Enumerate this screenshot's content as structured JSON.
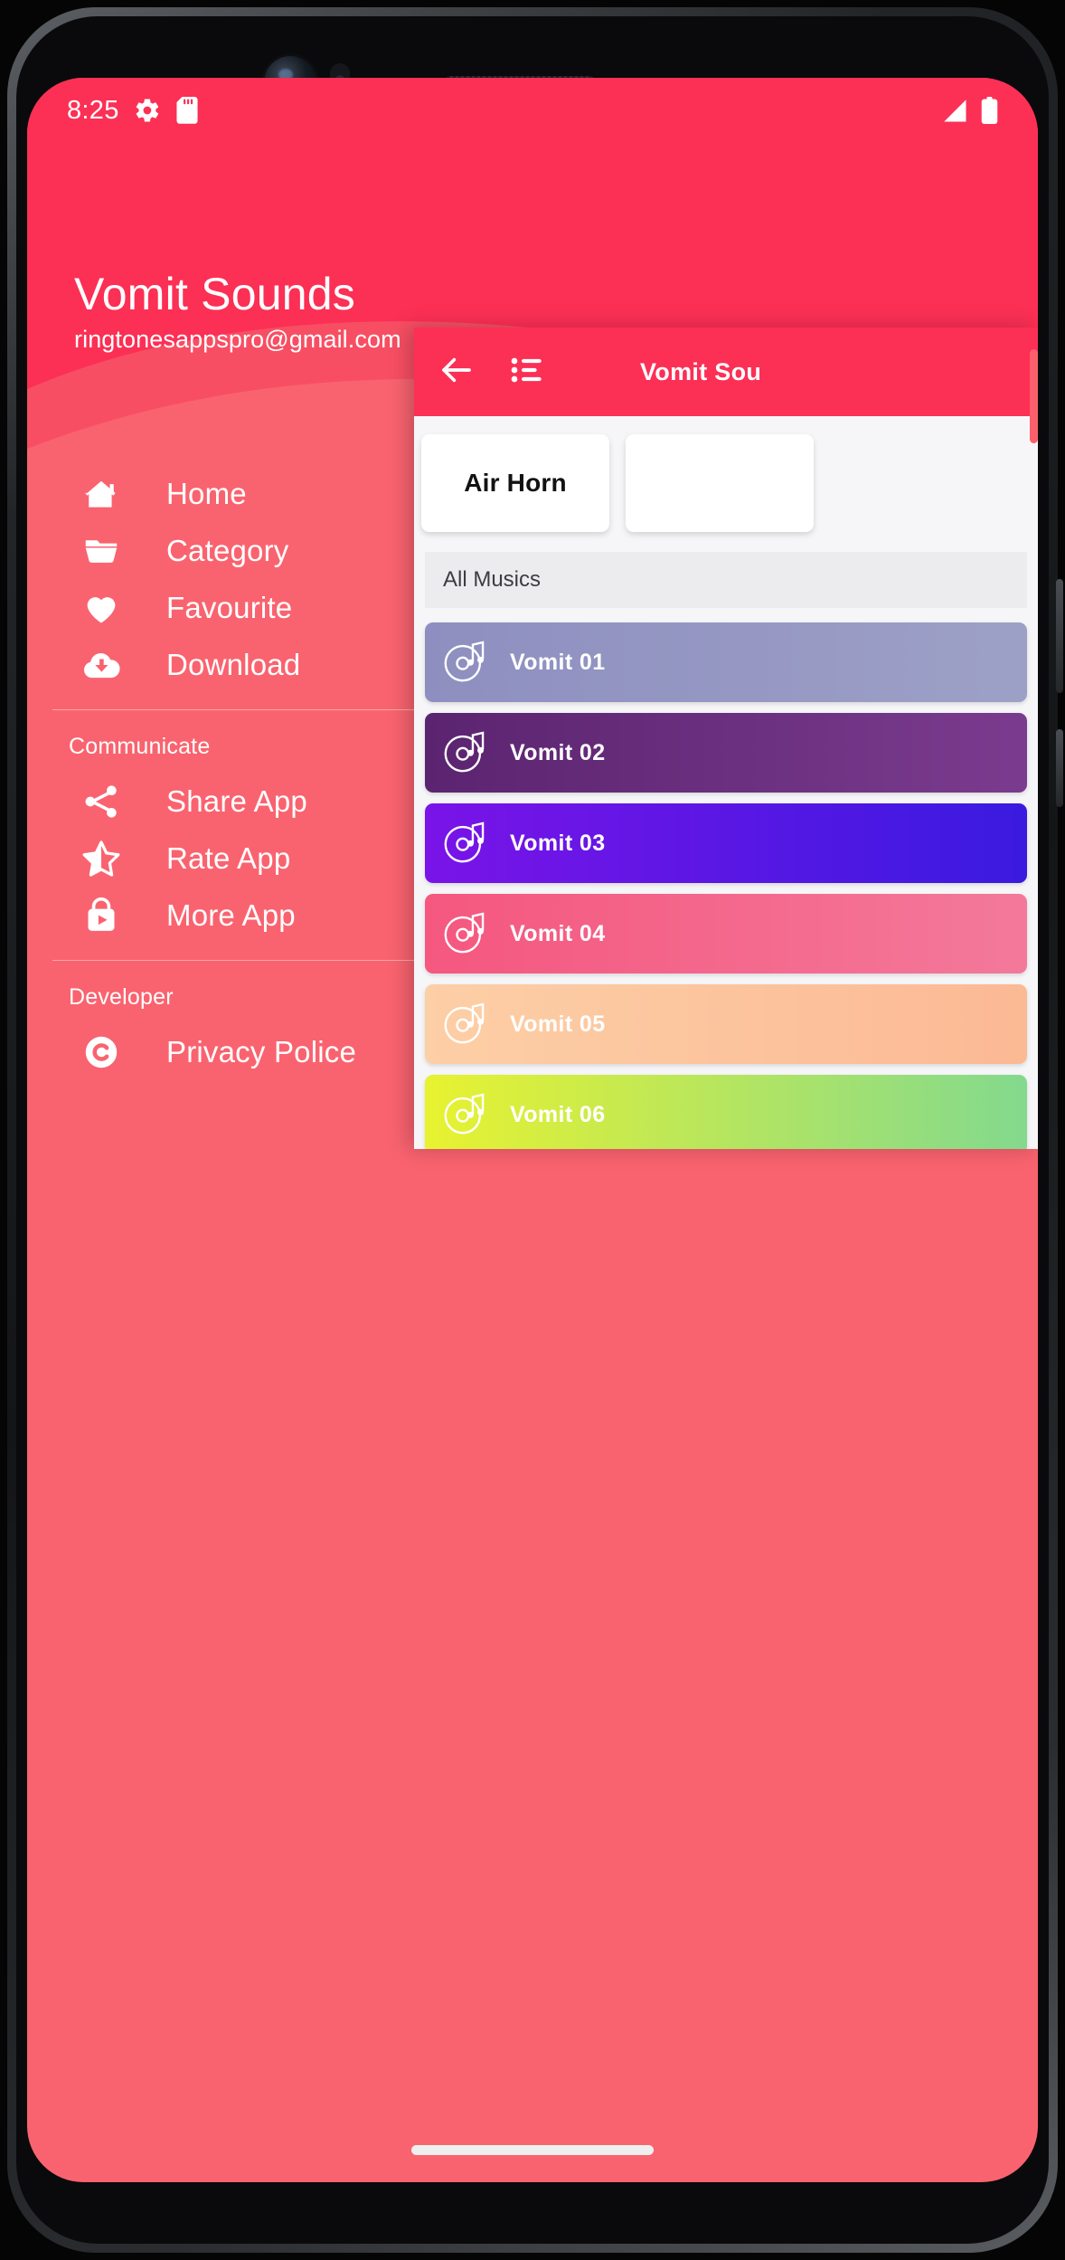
{
  "status_bar": {
    "time": "8:25",
    "left_icons": [
      "gear-icon",
      "sd-card-icon"
    ],
    "right_icons": [
      "signal-icon",
      "battery-icon"
    ]
  },
  "drawer": {
    "account": {
      "title": "Vomit Sounds",
      "email": "ringtonesappspro@gmail.com"
    },
    "primary_items": [
      {
        "label": "Home",
        "icon": "home-icon"
      },
      {
        "label": "Category",
        "icon": "folder-icon"
      },
      {
        "label": "Favourite",
        "icon": "heart-icon"
      },
      {
        "label": "Download",
        "icon": "cloud-download-icon"
      }
    ],
    "communicate_header": "Communicate",
    "communicate_items": [
      {
        "label": "Share App",
        "icon": "share-icon"
      },
      {
        "label": "Rate App",
        "icon": "star-half-icon"
      },
      {
        "label": "More App",
        "icon": "play-store-bag-icon"
      }
    ],
    "developer_header": "Developer",
    "developer_items": [
      {
        "label": "Privacy Police",
        "icon": "copyright-icon"
      }
    ]
  },
  "content_panel": {
    "back_icon": "back-arrow-icon",
    "list_icon": "list-menu-icon",
    "title": "Vomit Sou",
    "cards": [
      {
        "label": "Air Horn"
      },
      {
        "label": ""
      }
    ],
    "section_label": "All Musics",
    "tracks": [
      {
        "label": "Vomit 01",
        "color_from": "#8E8FC0",
        "color_to": "#9DA0C6"
      },
      {
        "label": "Vomit 02",
        "color_from": "#5B2470",
        "color_to": "#7B3B8E"
      },
      {
        "label": "Vomit 03",
        "color_from": "#7A14E8",
        "color_to": "#3A1AE0"
      },
      {
        "label": "Vomit 04",
        "color_from": "#F5577F",
        "color_to": "#F3799A"
      },
      {
        "label": "Vomit 05",
        "color_from": "#FDCFA6",
        "color_to": "#FBB994"
      },
      {
        "label": "Vomit 06",
        "color_from": "#E8F230",
        "color_to": "#83D98E"
      }
    ]
  },
  "colors": {
    "header_crimson": "#FC2F55",
    "drawer_body": "#F9636F",
    "wave_mid": "#F84E63",
    "wave_light": "#FA6A75",
    "panel_bg": "#F6F6F8"
  }
}
